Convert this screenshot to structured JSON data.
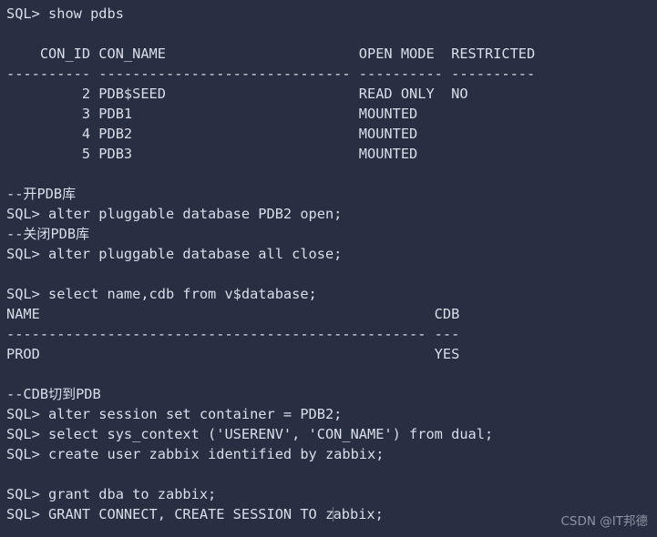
{
  "terminal": {
    "background_color": "#292f42",
    "text_color": "#d9dee8",
    "caret_color": "#e0504a",
    "prompt": "SQL>",
    "lines": [
      {
        "id": "cmd-show-pdbs",
        "text": "SQL> show pdbs"
      },
      {
        "id": "blank-1",
        "text": ""
      },
      {
        "id": "pdbs-header",
        "text": "    CON_ID CON_NAME                       OPEN MODE  RESTRICTED"
      },
      {
        "id": "pdbs-separator",
        "text": "---------- ------------------------------ ---------- ----------"
      },
      {
        "id": "pdbs-row-seed",
        "text": "         2 PDB$SEED                       READ ONLY  NO"
      },
      {
        "id": "pdbs-row-pdb1",
        "text": "         3 PDB1                           MOUNTED"
      },
      {
        "id": "pdbs-row-pdb2",
        "text": "         4 PDB2                           MOUNTED"
      },
      {
        "id": "pdbs-row-pdb3",
        "text": "         5 PDB3                           MOUNTED"
      },
      {
        "id": "blank-2",
        "text": ""
      },
      {
        "id": "comment-open-pdb",
        "text": "--开PDB库"
      },
      {
        "id": "cmd-open-pdb2",
        "text": "SQL> alter pluggable database PDB2 open;"
      },
      {
        "id": "comment-close-pdb",
        "text": "--关闭PDB库"
      },
      {
        "id": "cmd-close-all",
        "text": "SQL> alter pluggable database all close;"
      },
      {
        "id": "blank-3",
        "text": ""
      },
      {
        "id": "cmd-select-vdatabase",
        "text": "SQL> select name,cdb from v$database;"
      },
      {
        "id": "vdb-header",
        "text": "NAME                                               CDB"
      },
      {
        "id": "vdb-separator",
        "text": "-------------------------------------------------- ---"
      },
      {
        "id": "vdb-row-prod",
        "text": "PROD                                               YES"
      },
      {
        "id": "blank-4",
        "text": ""
      },
      {
        "id": "comment-cdb-to-pdb",
        "text": "--CDB切到PDB"
      },
      {
        "id": "cmd-set-container",
        "text": "SQL> alter session set container = PDB2;"
      },
      {
        "id": "cmd-sys-context",
        "text": "SQL> select sys_context ('USERENV', 'CON_NAME') from dual;"
      },
      {
        "id": "cmd-create-user",
        "text": "SQL> create user zabbix identified by zabbix;"
      },
      {
        "id": "blank-5",
        "text": ""
      },
      {
        "id": "cmd-grant-dba",
        "text": "SQL> grant dba to zabbix;"
      },
      {
        "id": "cmd-grant-connect",
        "text": "SQL> GRANT CONNECT, CREATE SESSION TO zabbix;",
        "caret_after_column": 39
      }
    ]
  },
  "watermark": {
    "text": "CSDN @IT邦德",
    "color": "#8d94a3"
  }
}
